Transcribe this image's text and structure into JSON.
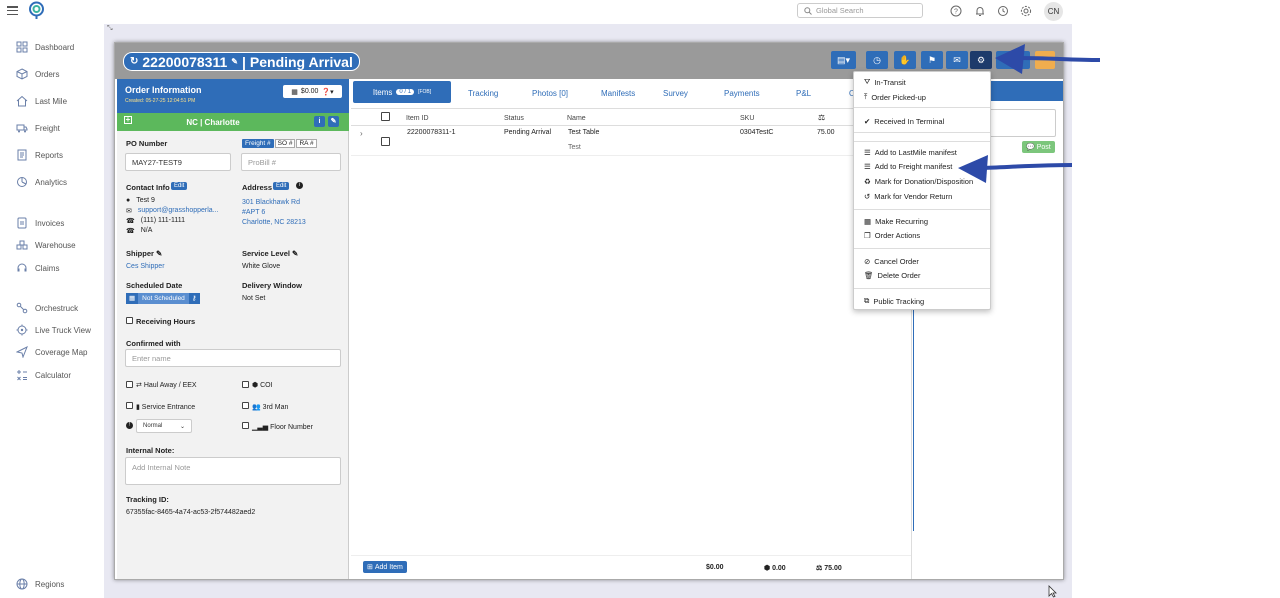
{
  "topbar": {
    "search_placeholder": "Global Search",
    "avatar": "CN"
  },
  "sidebar": {
    "items": [
      {
        "label": "Dashboard",
        "icon": "dashboard-icon"
      },
      {
        "label": "Orders",
        "icon": "cube-icon"
      },
      {
        "label": "Last Mile",
        "icon": "home-icon"
      },
      {
        "label": "Freight",
        "icon": "truck-icon"
      },
      {
        "label": "Reports",
        "icon": "report-icon"
      },
      {
        "label": "Analytics",
        "icon": "analytics-icon"
      },
      {
        "label": "Invoices",
        "icon": "invoice-icon"
      },
      {
        "label": "Warehouse",
        "icon": "warehouse-icon"
      },
      {
        "label": "Claims",
        "icon": "headset-icon"
      },
      {
        "label": "Orchestruck",
        "icon": "orchestruck-icon"
      },
      {
        "label": "Live Truck View",
        "icon": "target-icon"
      },
      {
        "label": "Coverage Map",
        "icon": "send-icon"
      },
      {
        "label": "Calculator",
        "icon": "calculator-icon"
      }
    ],
    "regions": "Regions"
  },
  "order": {
    "number": "22200078311",
    "status": "Pending Arrival",
    "info_title": "Order Information",
    "created": "Created: 05-27-25 12:04:51 PM",
    "amount": "$0.00",
    "location": "NC | Charlotte",
    "po_label": "PO Number",
    "po_value": "MAY27-TEST9",
    "freight_tag": "Freight #",
    "so_tag": "SO #",
    "ra_tag": "RA #",
    "probill_placeholder": "ProBill #",
    "contact_label": "Contact Info",
    "edit": "Edit",
    "contact_name": "Test 9",
    "contact_email": "support@grasshopperla...",
    "contact_phone": "(111) 111-1111",
    "contact_alt": "N/A",
    "address_label": "Address",
    "address_line1": "301 Blackhawk Rd",
    "address_line2": "#APT 6",
    "address_line3": "Charlotte, NC 28213",
    "shipper_label": "Shipper",
    "shipper_value": "Ces Shipper",
    "service_label": "Service Level",
    "service_value": "White Glove",
    "sched_label": "Scheduled Date",
    "sched_value": "Not Scheduled",
    "window_label": "Delivery Window",
    "window_value": "Not Set",
    "receiving": "Receiving Hours",
    "confirmed_label": "Confirmed with",
    "name_placeholder": "Enter name",
    "haul_away": "Haul Away / EEX",
    "coi": "COI",
    "service_entrance": "Service Entrance",
    "third_man": "3rd Man",
    "priority": "Normal",
    "floor_number": "Floor Number",
    "note_label": "Internal Note:",
    "note_placeholder": "Add Internal Note",
    "tracking_label": "Tracking ID:",
    "tracking_value": "67355fac-8465-4a74-ac53-2f574482aed2"
  },
  "tabs": {
    "items": "Items",
    "items_count": "0 / 1",
    "items_tag": "[FOB]",
    "tracking": "Tracking",
    "photos": "Photos [0]",
    "manifests": "Manifests",
    "survey": "Survey",
    "payments": "Payments",
    "pl": "P&L",
    "overflow": "O"
  },
  "table": {
    "headers": [
      "Item ID",
      "Status",
      "Name",
      "SKU"
    ],
    "rows": [
      {
        "id": "22200078311-1",
        "status": "Pending Arrival",
        "name": "Test Table",
        "sub": "Test",
        "sku": "0304TestC",
        "weight": "75.00"
      }
    ]
  },
  "footer": {
    "add_item": "Add Item",
    "total_price": "$0.00",
    "total_vol": "0.00",
    "total_weight": "75.00"
  },
  "right": {
    "post": "Post",
    "note_placeholder": "te"
  },
  "menu": {
    "group1": [
      "In-Transit",
      "Order Picked-up"
    ],
    "group2": [
      "Received In Terminal"
    ],
    "group3": [
      "Add to LastMile manifest",
      "Add to Freight manifest",
      "Mark for Donation/Disposition",
      "Mark for Vendor Return"
    ],
    "group4": [
      "Make Recurring",
      "Order Actions"
    ],
    "group5": [
      "Cancel Order",
      "Delete Order"
    ],
    "group6": [
      "Public Tracking"
    ]
  },
  "colors": {
    "brand": "#2f6db8",
    "success": "#5cb85c",
    "arrow": "#2d4aa8",
    "warning": "#f0ad4e"
  }
}
